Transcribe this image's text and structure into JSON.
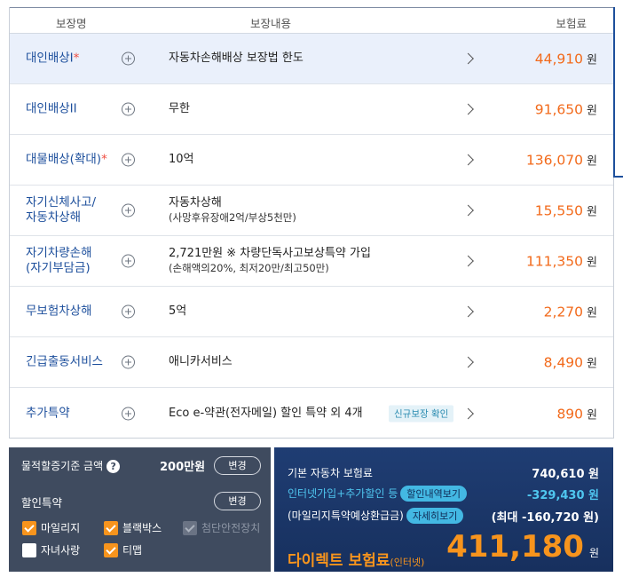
{
  "table": {
    "headers": {
      "name": "보장명",
      "content": "보장내용",
      "premium": "보험료"
    },
    "currency": "원",
    "rows": [
      {
        "name": "대인배상I",
        "star": "*",
        "desc": "자동차손해배상 보장법 한도",
        "sub": "",
        "tag": "",
        "price": "44,910"
      },
      {
        "name": "대인배상II",
        "star": "",
        "desc": "무한",
        "sub": "",
        "tag": "",
        "price": "91,650"
      },
      {
        "name": "대물배상(확대)",
        "star": "*",
        "desc": "10억",
        "sub": "",
        "tag": "",
        "price": "136,070"
      },
      {
        "name": "자기신체사고/",
        "name2": "자동차상해",
        "star": "",
        "desc": "자동차상해",
        "sub": "(사망후유장애2억/부상5천만)",
        "tag": "",
        "price": "15,550"
      },
      {
        "name": "자기차량손해",
        "name2": "(자기부담금)",
        "star": "",
        "desc": "2,721만원 ※ 차량단독사고보상특약 가입",
        "sub": "(손해액의20%, 최저20만/최고50만)",
        "tag": "",
        "price": "111,350"
      },
      {
        "name": "무보험차상해",
        "star": "",
        "desc": "5억",
        "sub": "",
        "tag": "",
        "price": "2,270"
      },
      {
        "name": "긴급출동서비스",
        "star": "",
        "desc": "애니카서비스",
        "sub": "",
        "tag": "",
        "price": "8,490"
      },
      {
        "name": "추가특약",
        "star": "",
        "desc": "Eco e-약관(전자메일) 할인 특약 외 4개",
        "sub": "",
        "tag": "신규보장 확인",
        "price": "890"
      }
    ]
  },
  "left_panel": {
    "property_label": "물적할증기준 금액",
    "property_help": "?",
    "property_amount": "200만원",
    "change_label": "변경",
    "discount_label": "할인특약",
    "discount_change_label": "변경",
    "options": {
      "mileage": "마일리지",
      "blackbox": "블랙박스",
      "advanced_safety": "첨단안전장치",
      "child_love": "자녀사랑",
      "tmap": "티맵"
    }
  },
  "right_panel": {
    "base_label": "기본 자동차 보험료",
    "base_value": "740,610 원",
    "internet_label": "인터넷가입+추가할인 등",
    "internet_btn": "할인내역보기",
    "internet_value": "-329,430 원",
    "mileage_label": "(마일리지특약예상환급금)",
    "mileage_btn": "자세히보기",
    "mileage_value": "(최대 -160,720 원)",
    "total_label": "다이렉트 보험료",
    "total_sub": "(인터넷)",
    "total_value": "411,180",
    "total_unit": "원"
  },
  "colors": {
    "accent_orange": "#f26a1b",
    "navy": "#1d4f9c",
    "panel_dark": "#3f4b5f",
    "panel_blue": "#1f3d73",
    "cyan": "#4fc6ef"
  }
}
